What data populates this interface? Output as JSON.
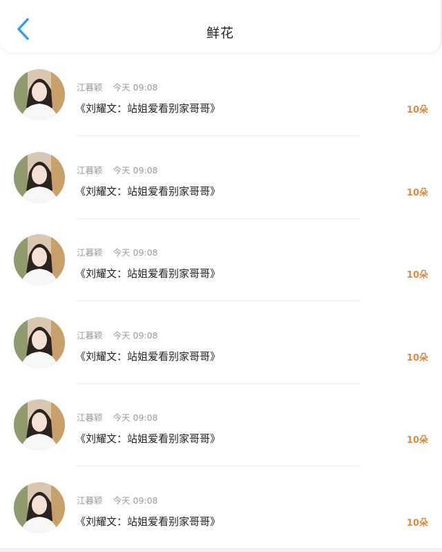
{
  "header": {
    "title": "鲜花",
    "back_icon": "chevron-left-icon",
    "accent_color": "#2a9df4"
  },
  "items": [
    {
      "name": "江暮颖",
      "time": "今天 09:08",
      "message": "《刘耀文：站姐爱看别家哥哥》",
      "count": "10朵"
    },
    {
      "name": "江暮颖",
      "time": "今天 09:08",
      "message": "《刘耀文：站姐爱看别家哥哥》",
      "count": "10朵"
    },
    {
      "name": "江暮颖",
      "time": "今天 09:08",
      "message": "《刘耀文：站姐爱看别家哥哥》",
      "count": "10朵"
    },
    {
      "name": "江暮颖",
      "time": "今天 09:08",
      "message": "《刘耀文：站姐爱看别家哥哥》",
      "count": "10朵"
    },
    {
      "name": "江暮颖",
      "time": "今天 09:08",
      "message": "《刘耀文：站姐爱看别家哥哥》",
      "count": "10朵"
    },
    {
      "name": "江暮颖",
      "time": "今天 09:08",
      "message": "《刘耀文：站姐爱看别家哥哥》",
      "count": "10朵"
    }
  ],
  "colors": {
    "count": "#d98b45",
    "meta": "#9a9a9a",
    "text": "#222222"
  }
}
